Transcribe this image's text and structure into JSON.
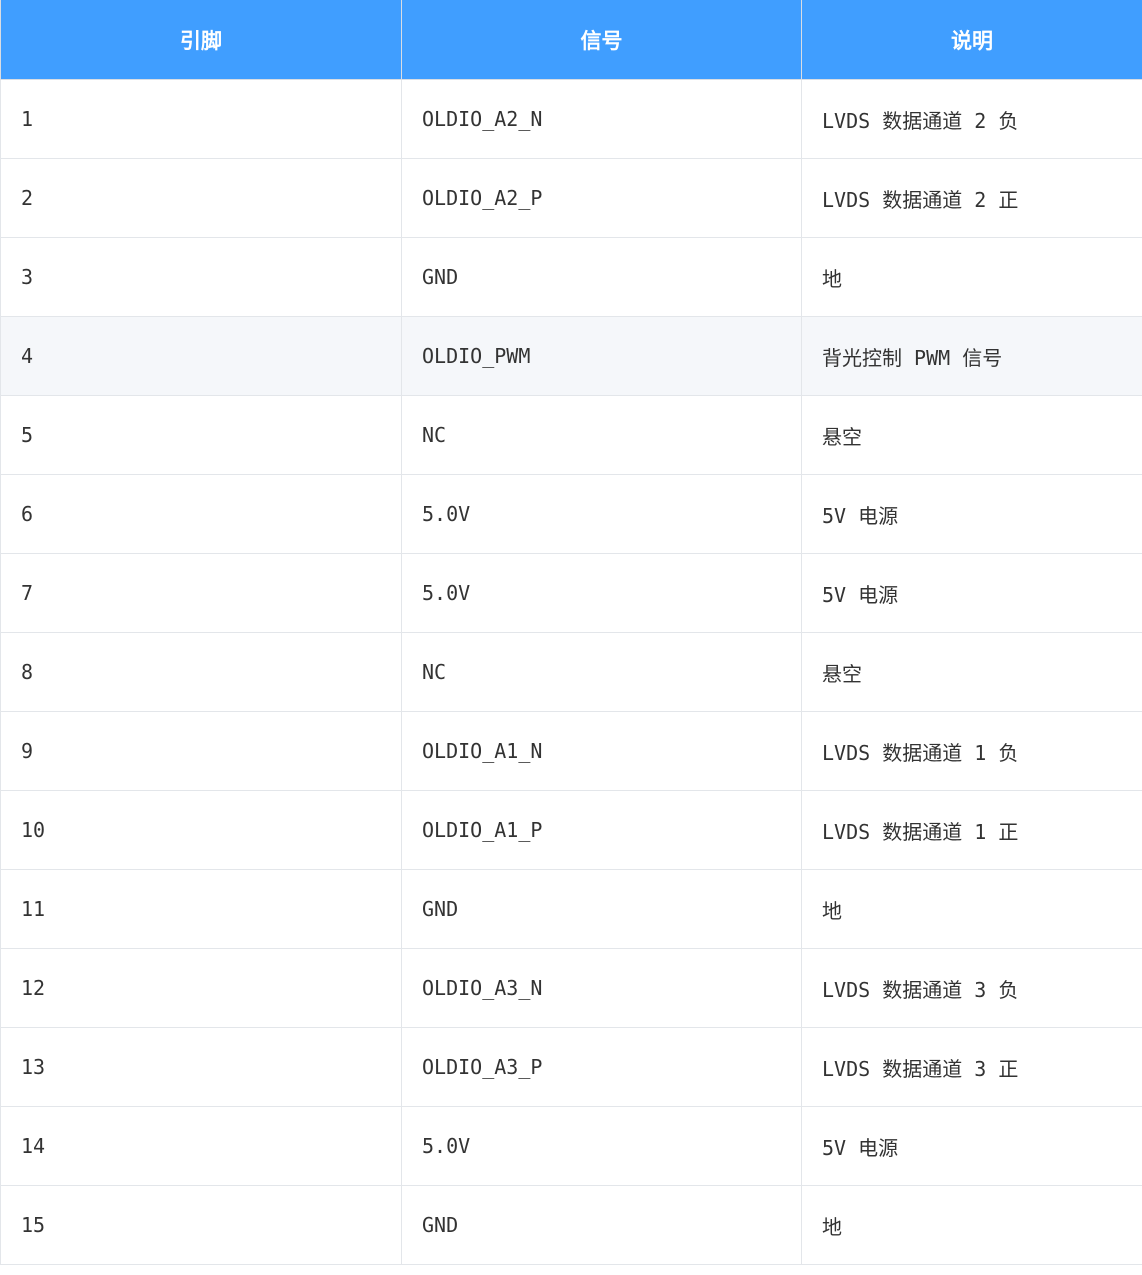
{
  "table": {
    "headers": [
      "引脚",
      "信号",
      "说明"
    ],
    "rows": [
      {
        "pin": "1",
        "signal": "OLDIO_A2_N",
        "desc": "LVDS 数据通道 2 负"
      },
      {
        "pin": "2",
        "signal": "OLDIO_A2_P",
        "desc": "LVDS 数据通道 2 正"
      },
      {
        "pin": "3",
        "signal": "GND",
        "desc": "地"
      },
      {
        "pin": "4",
        "signal": "OLDIO_PWM",
        "desc": "背光控制 PWM 信号"
      },
      {
        "pin": "5",
        "signal": "NC",
        "desc": "悬空"
      },
      {
        "pin": "6",
        "signal": "5.0V",
        "desc": "5V 电源"
      },
      {
        "pin": "7",
        "signal": "5.0V",
        "desc": "5V 电源"
      },
      {
        "pin": "8",
        "signal": "NC",
        "desc": "悬空"
      },
      {
        "pin": "9",
        "signal": "OLDIO_A1_N",
        "desc": "LVDS 数据通道 1 负"
      },
      {
        "pin": "10",
        "signal": "OLDIO_A1_P",
        "desc": "LVDS 数据通道 1 正"
      },
      {
        "pin": "11",
        "signal": "GND",
        "desc": "地"
      },
      {
        "pin": "12",
        "signal": "OLDIO_A3_N",
        "desc": "LVDS 数据通道 3 负"
      },
      {
        "pin": "13",
        "signal": "OLDIO_A3_P",
        "desc": "LVDS 数据通道 3 正"
      },
      {
        "pin": "14",
        "signal": "5.0V",
        "desc": "5V 电源"
      },
      {
        "pin": "15",
        "signal": "GND",
        "desc": "地"
      }
    ]
  },
  "colors": {
    "header_background": "#409eff",
    "header_text": "#ffffff",
    "highlight_row_background": "#f5f7fa",
    "border": "#e3e6ea"
  }
}
